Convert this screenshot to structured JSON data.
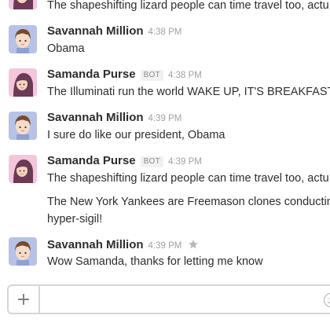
{
  "messages": [
    {
      "sender": "",
      "bot_badge": "",
      "time": "",
      "lines": [
        "The shapeshifting lizard people can time travel too, actu"
      ],
      "avatar": "girl"
    },
    {
      "sender": "Savannah Million",
      "time": "4:38 PM",
      "lines": [
        "Obama"
      ],
      "avatar": "boy"
    },
    {
      "sender": "Samanda Purse",
      "bot_badge": "BOT",
      "time": "4:38 PM",
      "lines": [
        "The Illuminati run the world WAKE UP, IT'S BREAKFAST"
      ],
      "avatar": "girl"
    },
    {
      "sender": "Savannah Million",
      "time": "4:39 PM",
      "lines": [
        "I sure do like our president, Obama"
      ],
      "avatar": "boy"
    },
    {
      "sender": "Samanda Purse",
      "bot_badge": "BOT",
      "time": "4:39 PM",
      "lines": [
        "The shapeshifting lizard people can time travel too, actu"
      ],
      "paragraph2": [
        "The New York Yankees are Freemason clones conducting",
        "hyper-sigil!"
      ],
      "avatar": "girl"
    },
    {
      "sender": "Savannah Million",
      "time": "4:39 PM",
      "lines": [
        "Wow Samanda, thanks for letting me know"
      ],
      "avatar": "boy",
      "starred": true
    }
  ],
  "composer": {
    "plus_label": "+",
    "placeholder": ""
  },
  "icons": {
    "star": "star-icon",
    "emoji": "emoji-icon",
    "plus": "plus-icon"
  },
  "colors": {
    "girl_avatar_bg": "#f3c6dc",
    "boy_avatar_bg": "#b6c3e6",
    "sender": "#2c2d30",
    "timestamp": "#a0a0a2"
  }
}
